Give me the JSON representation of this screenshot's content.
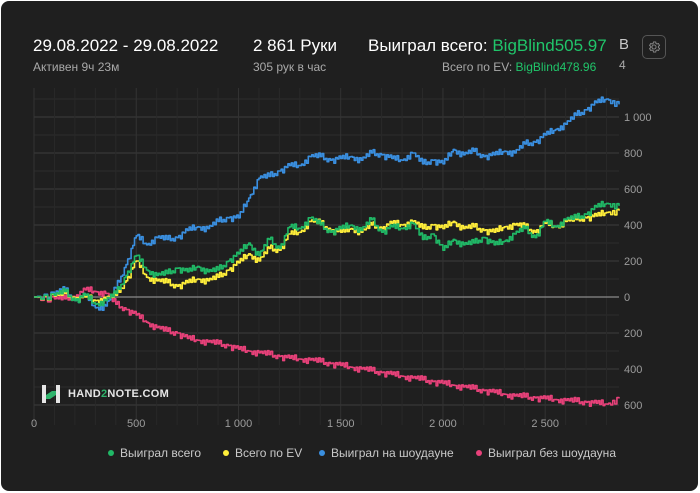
{
  "header": {
    "date_range": "29.08.2022 - 29.08.2022",
    "active": "Активен 9ч 23м",
    "hands": "2 861 Руки",
    "hands_rate": "305 рук в час",
    "won_label": "Выиграл всего:",
    "won_value": "BigBlind505.97",
    "ev_label": "Всего по EV:",
    "ev_value": "BigBlind478.96",
    "cut_top": "В",
    "cut_bottom": "4"
  },
  "settings_icon": "gear-icon",
  "watermark": {
    "part1": "HAND",
    "part2": "2",
    "part3": "NOTE.COM"
  },
  "colors": {
    "won_total": "#20b866",
    "ev_total": "#ffee3a",
    "showdown": "#3a8fe0",
    "non_showdown": "#e8417a",
    "accent_text": "#20c56a"
  },
  "chart_data": {
    "type": "line",
    "x_ticks": [
      "0",
      "500",
      "1 000",
      "1 500",
      "2 000",
      "2 500"
    ],
    "x_tick_values": [
      0,
      500,
      1000,
      1500,
      2000,
      2500
    ],
    "y_ticks": [
      "1 000",
      "800",
      "600",
      "400",
      "200",
      "0",
      "200",
      "400",
      "600"
    ],
    "y_tick_values": [
      1000,
      800,
      600,
      400,
      200,
      0,
      -200,
      -400,
      -600
    ],
    "xlim": [
      0,
      2861
    ],
    "ylim": [
      -620,
      1150
    ],
    "grid": true,
    "legend_position": "bottom",
    "series": [
      {
        "name": "Выиграл всего",
        "color": "#20b866",
        "x": [
          0,
          100,
          150,
          200,
          250,
          300,
          350,
          400,
          450,
          500,
          550,
          600,
          650,
          700,
          750,
          800,
          850,
          900,
          950,
          1000,
          1050,
          1100,
          1150,
          1200,
          1250,
          1300,
          1350,
          1400,
          1450,
          1500,
          1550,
          1600,
          1650,
          1700,
          1750,
          1800,
          1850,
          1900,
          1950,
          2000,
          2050,
          2100,
          2150,
          2200,
          2250,
          2300,
          2350,
          2400,
          2450,
          2500,
          2550,
          2600,
          2650,
          2700,
          2750,
          2800,
          2861
        ],
        "y": [
          0,
          10,
          30,
          -20,
          10,
          -40,
          -20,
          20,
          120,
          230,
          150,
          120,
          130,
          160,
          140,
          170,
          140,
          150,
          200,
          240,
          300,
          230,
          320,
          270,
          390,
          380,
          440,
          400,
          360,
          380,
          400,
          370,
          430,
          360,
          390,
          380,
          410,
          320,
          350,
          260,
          320,
          290,
          300,
          330,
          290,
          310,
          350,
          380,
          330,
          420,
          390,
          430,
          440,
          460,
          500,
          520,
          506
        ]
      },
      {
        "name": "Всего по EV",
        "color": "#ffee3a",
        "x": [
          0,
          100,
          150,
          200,
          250,
          300,
          350,
          400,
          450,
          500,
          550,
          600,
          650,
          700,
          750,
          800,
          850,
          900,
          950,
          1000,
          1050,
          1100,
          1150,
          1200,
          1250,
          1300,
          1350,
          1400,
          1450,
          1500,
          1550,
          1600,
          1650,
          1700,
          1750,
          1800,
          1850,
          1900,
          1950,
          2000,
          2050,
          2100,
          2150,
          2200,
          2250,
          2300,
          2350,
          2400,
          2450,
          2500,
          2550,
          2600,
          2650,
          2700,
          2750,
          2800,
          2861
        ],
        "y": [
          0,
          5,
          20,
          -10,
          0,
          -20,
          -10,
          10,
          90,
          200,
          110,
          90,
          80,
          60,
          80,
          100,
          90,
          110,
          150,
          190,
          240,
          200,
          270,
          260,
          350,
          360,
          420,
          410,
          370,
          360,
          380,
          360,
          400,
          380,
          410,
          400,
          420,
          380,
          400,
          380,
          420,
          380,
          390,
          370,
          360,
          390,
          400,
          390,
          360,
          410,
          390,
          420,
          430,
          440,
          450,
          470,
          479
        ]
      },
      {
        "name": "Выиграл на шоудауне",
        "color": "#3a8fe0",
        "x": [
          0,
          100,
          150,
          200,
          250,
          300,
          350,
          400,
          450,
          500,
          550,
          600,
          650,
          700,
          750,
          800,
          850,
          900,
          950,
          1000,
          1050,
          1100,
          1150,
          1200,
          1250,
          1300,
          1350,
          1400,
          1450,
          1500,
          1550,
          1600,
          1650,
          1700,
          1750,
          1800,
          1850,
          1900,
          1950,
          2000,
          2050,
          2100,
          2150,
          2200,
          2250,
          2300,
          2350,
          2400,
          2450,
          2500,
          2550,
          2600,
          2650,
          2700,
          2750,
          2800,
          2861
        ],
        "y": [
          0,
          20,
          40,
          -20,
          10,
          -60,
          -50,
          50,
          180,
          340,
          290,
          330,
          320,
          330,
          370,
          390,
          380,
          420,
          440,
          440,
          550,
          660,
          670,
          700,
          730,
          730,
          780,
          780,
          760,
          770,
          780,
          760,
          800,
          790,
          770,
          760,
          800,
          740,
          760,
          740,
          820,
          790,
          810,
          780,
          790,
          810,
          800,
          850,
          860,
          900,
          930,
          960,
          1010,
          1040,
          1080,
          1100,
          1070
        ]
      },
      {
        "name": "Выиграл без шоудауна",
        "color": "#e8417a",
        "x": [
          0,
          100,
          150,
          200,
          250,
          300,
          350,
          400,
          450,
          500,
          550,
          600,
          650,
          700,
          750,
          800,
          850,
          900,
          950,
          1000,
          1050,
          1100,
          1150,
          1200,
          1250,
          1300,
          1350,
          1400,
          1450,
          1500,
          1550,
          1600,
          1650,
          1700,
          1750,
          1800,
          1850,
          1900,
          1950,
          2000,
          2050,
          2100,
          2150,
          2200,
          2250,
          2300,
          2350,
          2400,
          2450,
          2500,
          2550,
          2600,
          2650,
          2700,
          2750,
          2800,
          2861
        ],
        "y": [
          0,
          -10,
          -10,
          0,
          40,
          30,
          20,
          -40,
          -70,
          -100,
          -140,
          -170,
          -190,
          -200,
          -230,
          -240,
          -250,
          -260,
          -270,
          -290,
          -300,
          -310,
          -320,
          -330,
          -340,
          -345,
          -350,
          -360,
          -370,
          -380,
          -390,
          -400,
          -410,
          -420,
          -430,
          -440,
          -450,
          -460,
          -470,
          -480,
          -490,
          -500,
          -510,
          -520,
          -530,
          -540,
          -550,
          -555,
          -560,
          -565,
          -570,
          -575,
          -580,
          -585,
          -590,
          -595,
          -564
        ]
      }
    ]
  }
}
